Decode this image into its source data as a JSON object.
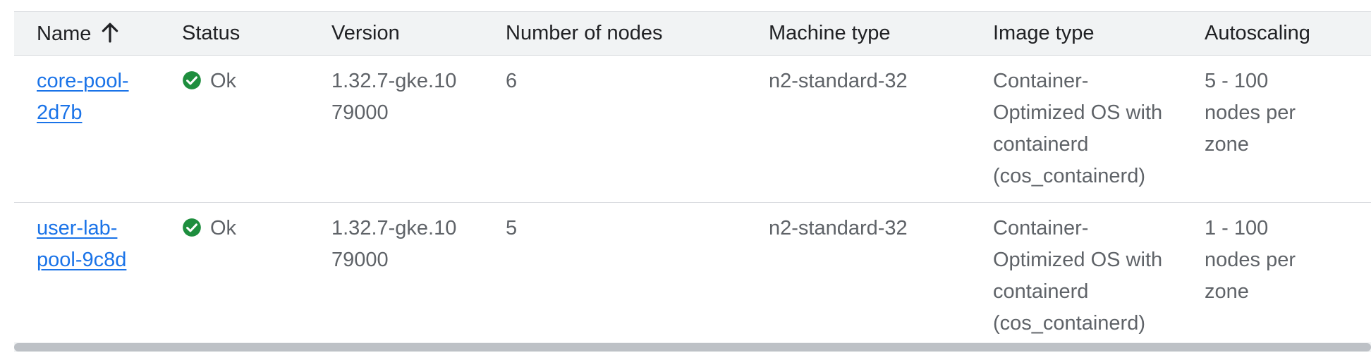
{
  "table": {
    "columns": [
      {
        "key": "name",
        "label": "Name"
      },
      {
        "key": "status",
        "label": "Status"
      },
      {
        "key": "version",
        "label": "Version"
      },
      {
        "key": "nodes",
        "label": "Number of nodes"
      },
      {
        "key": "machine",
        "label": "Machine type"
      },
      {
        "key": "image",
        "label": "Image type"
      },
      {
        "key": "autoscaling",
        "label": "Autoscaling"
      }
    ],
    "sort": {
      "column": "name",
      "direction": "ascending",
      "icon": "arrow-up-icon"
    },
    "rows": [
      {
        "name": "core-pool-2d7b",
        "status": "Ok",
        "version": "1.32.7-gke.1079000",
        "nodes": "6",
        "machine": "n2-standard-32",
        "image": "Container-Optimized OS with containerd (cos_containerd)",
        "autoscaling": "5 - 100 nodes per zone"
      },
      {
        "name": "user-lab-pool-9c8d",
        "status": "Ok",
        "version": "1.32.7-gke.1079000",
        "nodes": "5",
        "machine": "n2-standard-32",
        "image": "Container-Optimized OS with containerd (cos_containerd)",
        "autoscaling": "1 - 100 nodes per zone"
      }
    ]
  },
  "colors": {
    "link": "#1a73e8",
    "status_ok": "#1e8e3e",
    "header_bg": "#f1f3f4",
    "text": "#5f6368",
    "header_text": "#202124"
  }
}
